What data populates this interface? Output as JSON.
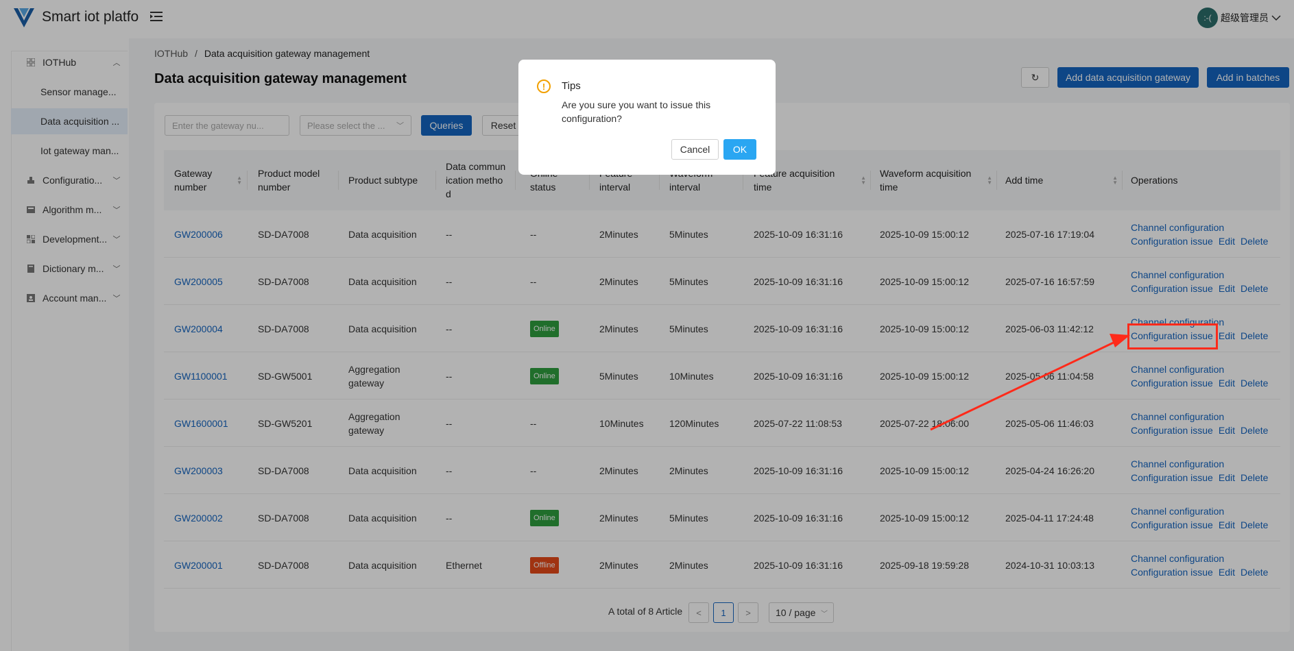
{
  "header": {
    "app_title": "Smart iot platfor",
    "user_name": "超级管理员",
    "avatar_text": ":-("
  },
  "sidebar": {
    "items": [
      {
        "label": "IOTHub",
        "icon": "grid-icon",
        "chevron": "^"
      },
      {
        "label": "Sensor manage...",
        "sub": true
      },
      {
        "label": "Data acquisition ...",
        "sub": true,
        "active": true
      },
      {
        "label": "Iot gateway man...",
        "sub": true
      },
      {
        "label": "Configuratio...",
        "icon": "config-icon",
        "chevron": "v"
      },
      {
        "label": "Algorithm m...",
        "icon": "algorithm-icon",
        "chevron": "v"
      },
      {
        "label": "Development...",
        "icon": "dev-icon",
        "chevron": "v"
      },
      {
        "label": "Dictionary m...",
        "icon": "dictionary-icon",
        "chevron": "v"
      },
      {
        "label": "Account man...",
        "icon": "account-icon",
        "chevron": "v"
      }
    ]
  },
  "breadcrumb": {
    "root": "IOTHub",
    "sep": "/",
    "current": "Data acquisition gateway management"
  },
  "page_title": "Data acquisition gateway management",
  "toolbar": {
    "refresh_icon": "↻",
    "add_label": "Add data acquisition gateway",
    "batch_label": "Add in batches"
  },
  "filters": {
    "gateway_placeholder": "Enter the gateway nu...",
    "select_placeholder": "Please select the ...",
    "query_label": "Queries",
    "reset_label": "Reset"
  },
  "table": {
    "headers": {
      "gateway_number": "Gateway number",
      "product_model": "Product model number",
      "product_subtype": "Product subtype",
      "data_comm": "Data communication method",
      "online_status": "Online status",
      "feature_interval": "Feature interval",
      "waveform_interval": "Waveform interval",
      "feature_time": "Feature acquisition time",
      "waveform_time": "Waveform acquisition time",
      "add_time": "Add time",
      "operations": "Operations"
    },
    "rows": [
      {
        "gw": "GW200006",
        "model": "SD-DA7008",
        "subtype": "Data acquisition",
        "comm": "--",
        "status": "--",
        "fi": "2Minutes",
        "wi": "5Minutes",
        "ft": "2025-10-09 16:31:16",
        "wt": "2025-10-09 15:00:12",
        "at": "2025-07-16 17:19:04"
      },
      {
        "gw": "GW200005",
        "model": "SD-DA7008",
        "subtype": "Data acquisition",
        "comm": "--",
        "status": "--",
        "fi": "2Minutes",
        "wi": "5Minutes",
        "ft": "2025-10-09 16:31:16",
        "wt": "2025-10-09 15:00:12",
        "at": "2025-07-16 16:57:59"
      },
      {
        "gw": "GW200004",
        "model": "SD-DA7008",
        "subtype": "Data acquisition",
        "comm": "--",
        "status": "Online",
        "fi": "2Minutes",
        "wi": "5Minutes",
        "ft": "2025-10-09 16:31:16",
        "wt": "2025-10-09 15:00:12",
        "at": "2025-06-03 11:42:12"
      },
      {
        "gw": "GW1100001",
        "model": "SD-GW5001",
        "subtype": "Aggregation gateway",
        "comm": "--",
        "status": "Online",
        "fi": "5Minutes",
        "wi": "10Minutes",
        "ft": "2025-10-09 16:31:16",
        "wt": "2025-10-09 15:00:12",
        "at": "2025-05-06 11:04:58"
      },
      {
        "gw": "GW1600001",
        "model": "SD-GW5201",
        "subtype": "Aggregation gateway",
        "comm": "--",
        "status": "--",
        "fi": "10Minutes",
        "wi": "120Minutes",
        "ft": "2025-07-22 11:08:53",
        "wt": "2025-07-22 18:06:00",
        "at": "2025-05-06 11:46:03"
      },
      {
        "gw": "GW200003",
        "model": "SD-DA7008",
        "subtype": "Data acquisition",
        "comm": "--",
        "status": "--",
        "fi": "2Minutes",
        "wi": "2Minutes",
        "ft": "2025-10-09 16:31:16",
        "wt": "2025-10-09 15:00:12",
        "at": "2025-04-24 16:26:20"
      },
      {
        "gw": "GW200002",
        "model": "SD-DA7008",
        "subtype": "Data acquisition",
        "comm": "--",
        "status": "Online",
        "fi": "2Minutes",
        "wi": "5Minutes",
        "ft": "2025-10-09 16:31:16",
        "wt": "2025-10-09 15:00:12",
        "at": "2025-04-11 17:24:48"
      },
      {
        "gw": "GW200001",
        "model": "SD-DA7008",
        "subtype": "Data acquisition",
        "comm": "Ethernet",
        "status": "Offline",
        "fi": "2Minutes",
        "wi": "2Minutes",
        "ft": "2025-10-09 16:31:16",
        "wt": "2025-09-18 19:59:28",
        "at": "2024-10-31 10:03:13"
      }
    ],
    "ops": {
      "channel_config": "Channel configuration",
      "config_issue": "Configuration issue",
      "edit": "Edit",
      "delete": "Delete"
    }
  },
  "pagination": {
    "total": "A total of 8 Article",
    "prev": "<",
    "current_page": "1",
    "next": ">",
    "page_size": "10 / page"
  },
  "dialog": {
    "title": "Tips",
    "message": "Are you sure you want to issue this configuration?",
    "cancel_label": "Cancel",
    "ok_label": "OK"
  },
  "colors": {
    "primary": "#1565c0",
    "ok_button": "#2aa6f2",
    "online": "#2e9e3e",
    "offline": "#e64a19",
    "annotation": "#ff2a1a",
    "warning": "#f2a000"
  }
}
